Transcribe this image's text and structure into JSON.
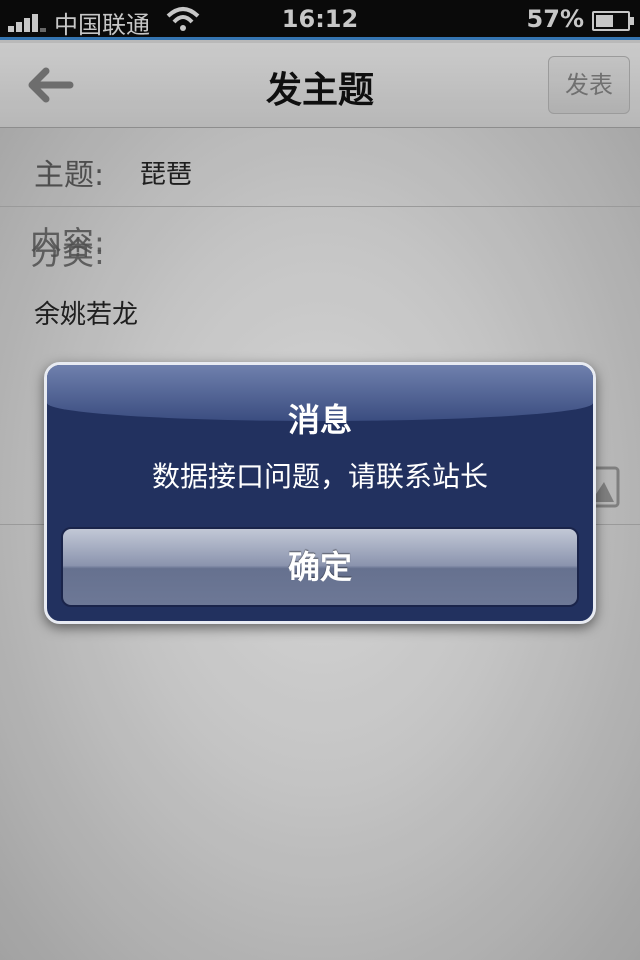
{
  "status_bar": {
    "carrier": "中国联通",
    "time": "16:12",
    "battery_percent": "57%",
    "battery_level": 0.57,
    "signal_bars": 4,
    "wifi_icon": "wifi-icon"
  },
  "navbar": {
    "title": "发主题",
    "back_icon": "back-arrow-icon",
    "publish_label": "发表"
  },
  "form": {
    "subject_label": "主题:",
    "subject_value": "琵琶",
    "category_label": "分类:",
    "content_label": "内容:",
    "content_value": "余姚若龙",
    "image_icon": "image-icon"
  },
  "alert": {
    "title": "消息",
    "message": "数据接口问题，请联系站长",
    "confirm_label": "确定"
  },
  "colors": {
    "alert_bg": "#22315f",
    "status_accent": "#3a7fc0"
  }
}
